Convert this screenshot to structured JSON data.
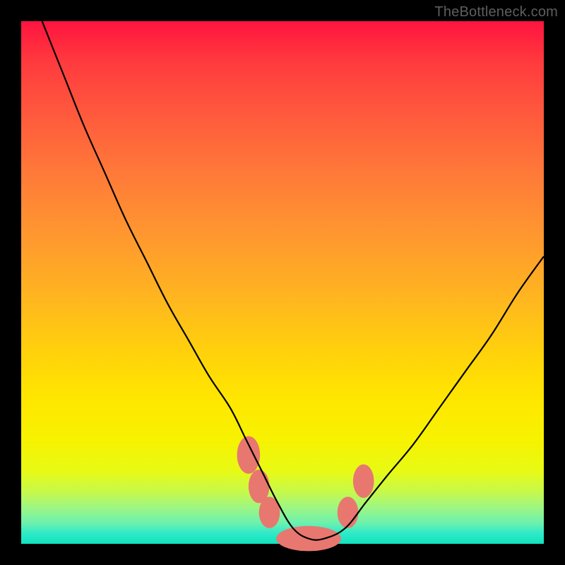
{
  "watermark": "TheBottleneck.com",
  "chart_data": {
    "type": "line",
    "title": "",
    "xlabel": "",
    "ylabel": "",
    "xlim": [
      0,
      100
    ],
    "ylim": [
      0,
      100
    ],
    "grid": false,
    "legend": false,
    "background": "red-yellow-green vertical gradient",
    "series": [
      {
        "name": "bottleneck-curve",
        "x": [
          4,
          8,
          12,
          16,
          20,
          24,
          28,
          32,
          36,
          40,
          43,
          46,
          49,
          52,
          55,
          58,
          62,
          66,
          70,
          75,
          80,
          85,
          90,
          95,
          100
        ],
        "values": [
          100,
          90,
          80,
          71,
          62,
          54,
          46,
          39,
          32,
          26,
          20,
          14,
          8,
          3,
          1,
          1,
          3,
          8,
          13,
          19,
          26,
          33,
          40,
          48,
          55
        ]
      }
    ],
    "markers": [
      {
        "name": "left-upper-blob",
        "x": 43.5,
        "y": 17,
        "rx": 2.2,
        "ry": 3.6
      },
      {
        "name": "left-mid-blob",
        "x": 45.5,
        "y": 11,
        "rx": 2.0,
        "ry": 3.2
      },
      {
        "name": "left-lower-blob",
        "x": 47.5,
        "y": 6,
        "rx": 2.0,
        "ry": 3.0
      },
      {
        "name": "trough-blob",
        "x": 55,
        "y": 1,
        "rx": 6.2,
        "ry": 2.4
      },
      {
        "name": "right-lower-blob",
        "x": 62.5,
        "y": 6,
        "rx": 2.0,
        "ry": 3.0
      },
      {
        "name": "right-upper-blob",
        "x": 65.5,
        "y": 12,
        "rx": 2.0,
        "ry": 3.2
      }
    ]
  }
}
